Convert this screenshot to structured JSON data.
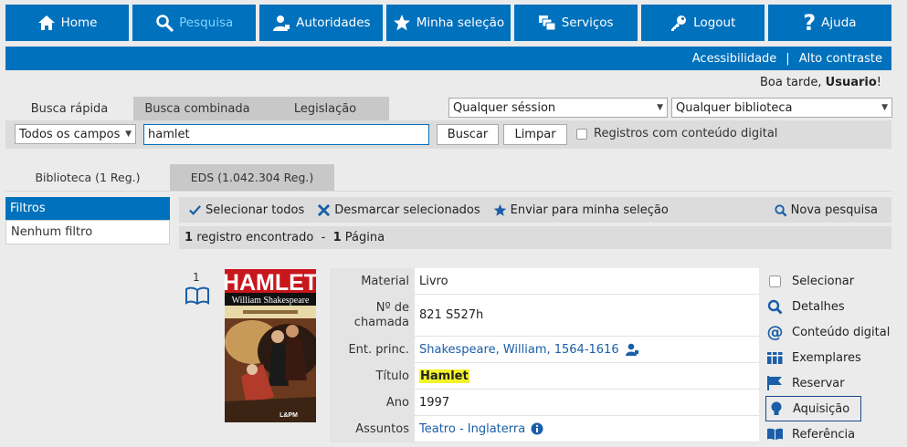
{
  "nav": [
    {
      "label": "Home",
      "icon": "home-icon"
    },
    {
      "label": "Pesquisa",
      "icon": "search-icon",
      "active": true
    },
    {
      "label": "Autoridades",
      "icon": "user-icon"
    },
    {
      "label": "Minha seleção",
      "icon": "star-icon"
    },
    {
      "label": "Serviços",
      "icon": "windows-icon"
    },
    {
      "label": "Logout",
      "icon": "key-icon"
    },
    {
      "label": "Ajuda",
      "icon": "question-icon"
    }
  ],
  "access_bar": {
    "accessibility": "Acessibilidade",
    "separator": "|",
    "contrast": "Alto contraste"
  },
  "greeting": {
    "text": "Boa tarde,",
    "user": "Usuario",
    "suffix": "!"
  },
  "search_tabs": [
    "Busca rápida",
    "Busca combinada",
    "Legislação"
  ],
  "search": {
    "session_select": "Qualquer séssion",
    "library_select": "Qualquer biblioteca",
    "field_select": "Todos os campos",
    "query": "hamlet",
    "search_button": "Buscar",
    "clear_button": "Limpar",
    "digital_checkbox": "Registros com conteúdo digital"
  },
  "result_tabs": [
    "Biblioteca (1 Reg.)",
    "EDS (1.042.304 Reg.)"
  ],
  "filters": {
    "header": "Filtros",
    "none": "Nenhum filtro"
  },
  "actions": {
    "select_all": "Selecionar todos",
    "deselect": "Desmarcar selecionados",
    "send": "Enviar para minha seleção",
    "new_search": "Nova pesquisa"
  },
  "count": {
    "records": "1",
    "records_label": "registro encontrado",
    "sep": "-",
    "pages": "1",
    "pages_label": "Página"
  },
  "record": {
    "number": "1",
    "cover": {
      "title": "HAMLET",
      "author": "William Shakespeare",
      "publisher": "L&PM"
    },
    "fields": [
      {
        "label": "Material",
        "value": "Livro"
      },
      {
        "label": "Nº de chamada",
        "value": "821 S527h"
      },
      {
        "label": "Ent. princ.",
        "value": "Shakespeare, William, 1564-1616"
      },
      {
        "label": "Título",
        "value": "Hamlet"
      },
      {
        "label": "Ano",
        "value": "1997"
      },
      {
        "label": "Assuntos",
        "value": "Teatro - Inglaterra"
      }
    ],
    "side_actions": [
      "Selecionar",
      "Detalhes",
      "Conteúdo digital",
      "Exemplares",
      "Reservar",
      "Aquisição",
      "Referência"
    ]
  },
  "colors": {
    "primary": "#0071bc",
    "active_nav_text": "#7fd4ff",
    "highlight": "#f3f32b",
    "link": "#1a5ea8"
  }
}
